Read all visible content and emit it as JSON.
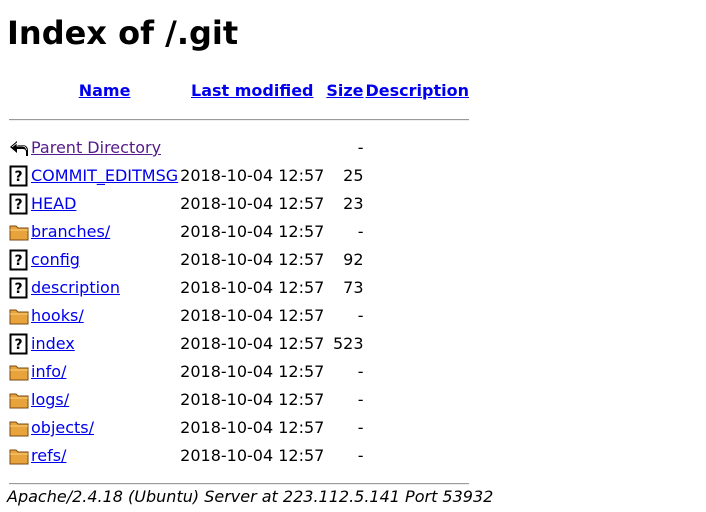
{
  "page": {
    "title": "Index of /.git"
  },
  "table": {
    "headers": {
      "name": "Name",
      "last_modified": "Last modified",
      "size": "Size",
      "description": "Description"
    },
    "parent": {
      "label": "Parent Directory",
      "icon": "back-arrow-icon",
      "size": "-"
    },
    "rows": [
      {
        "name": "COMMIT_EDITMSG",
        "modified": "2018-10-04 12:57",
        "size": "25",
        "icon": "unknown-file-icon"
      },
      {
        "name": "HEAD",
        "modified": "2018-10-04 12:57",
        "size": "23",
        "icon": "unknown-file-icon"
      },
      {
        "name": "branches/",
        "modified": "2018-10-04 12:57",
        "size": "-",
        "icon": "folder-icon"
      },
      {
        "name": "config",
        "modified": "2018-10-04 12:57",
        "size": "92",
        "icon": "unknown-file-icon"
      },
      {
        "name": "description",
        "modified": "2018-10-04 12:57",
        "size": "73",
        "icon": "unknown-file-icon"
      },
      {
        "name": "hooks/",
        "modified": "2018-10-04 12:57",
        "size": "-",
        "icon": "folder-icon"
      },
      {
        "name": "index",
        "modified": "2018-10-04 12:57",
        "size": "523",
        "icon": "unknown-file-icon"
      },
      {
        "name": "info/",
        "modified": "2018-10-04 12:57",
        "size": "-",
        "icon": "folder-icon"
      },
      {
        "name": "logs/",
        "modified": "2018-10-04 12:57",
        "size": "-",
        "icon": "folder-icon"
      },
      {
        "name": "objects/",
        "modified": "2018-10-04 12:57",
        "size": "-",
        "icon": "folder-icon"
      },
      {
        "name": "refs/",
        "modified": "2018-10-04 12:57",
        "size": "-",
        "icon": "folder-icon"
      }
    ]
  },
  "footer": {
    "address": "Apache/2.4.18 (Ubuntu) Server at 223.112.5.141 Port 53932"
  },
  "colors": {
    "link": "#0000ee",
    "visited_link": "#551a8b",
    "folder": "#e8a33c",
    "rule": "#9a9a9a"
  }
}
